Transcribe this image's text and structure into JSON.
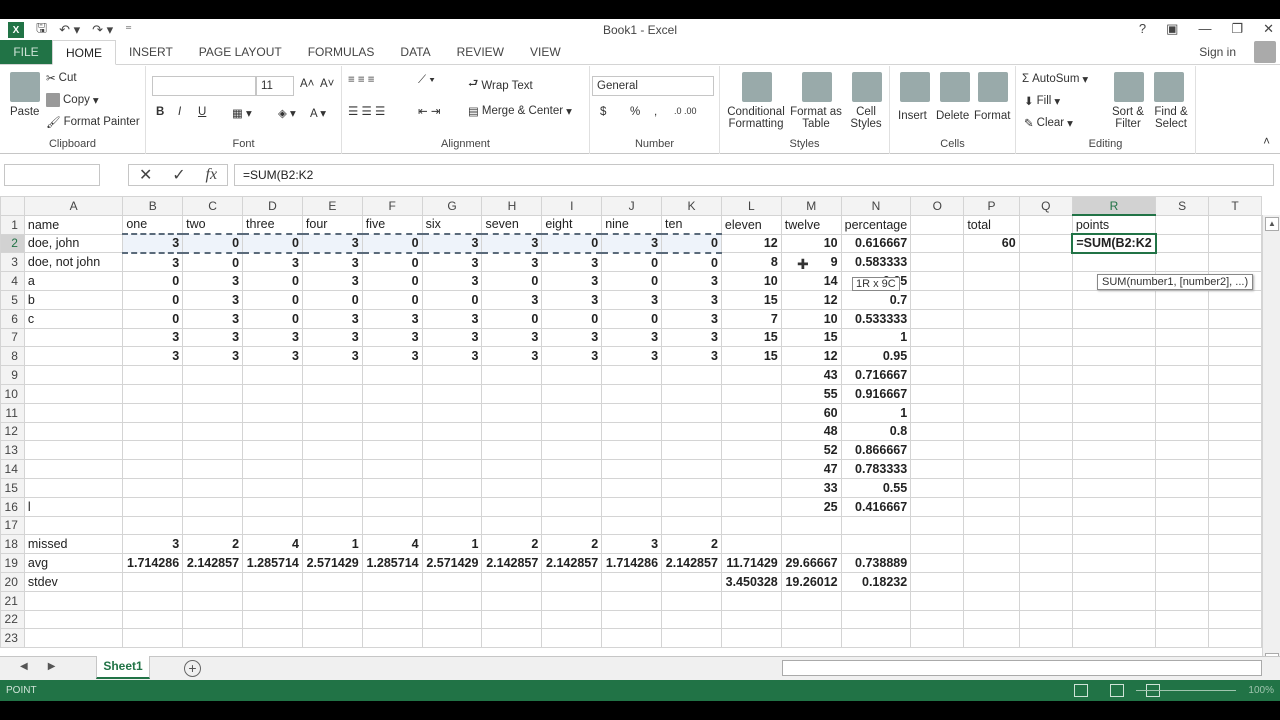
{
  "window": {
    "title": "Book1 - Excel",
    "controls": [
      "?",
      "ribbon-display",
      "minimize",
      "restore",
      "close"
    ]
  },
  "qat": {
    "undo_icon": "undo-icon",
    "redo_icon": "redo-icon",
    "save_icon": "save-icon"
  },
  "tabs": [
    "FILE",
    "HOME",
    "INSERT",
    "PAGE LAYOUT",
    "FORMULAS",
    "DATA",
    "REVIEW",
    "VIEW"
  ],
  "active_tab": "HOME",
  "signin": "Sign in",
  "ribbon": {
    "clipboard": {
      "label": "Clipboard",
      "paste": "Paste",
      "cut": "Cut",
      "copy": "Copy",
      "format_painter": "Format Painter"
    },
    "font": {
      "label": "Font",
      "font_name": "",
      "font_size": "11",
      "bold": "B",
      "italic": "I",
      "underline": "U"
    },
    "alignment": {
      "label": "Alignment",
      "wrap_text": "Wrap Text",
      "merge_center": "Merge & Center"
    },
    "number": {
      "label": "Number",
      "format": "General",
      "currency": "$",
      "percent": "%",
      "comma": ","
    },
    "styles": {
      "label": "Styles",
      "conditional": "Conditional Formatting",
      "format_table": "Format as Table",
      "cell_styles": "Cell Styles"
    },
    "cells": {
      "label": "Cells",
      "insert": "Insert",
      "delete": "Delete",
      "format": "Format"
    },
    "editing": {
      "label": "Editing",
      "autosum": "AutoSum",
      "fill": "Fill",
      "clear": "Clear",
      "sort_filter": "Sort & Filter",
      "find_select": "Find & Select"
    }
  },
  "formula_bar": {
    "name_box": "",
    "cancel": "✕",
    "enter": "✓",
    "fx": "fx",
    "formula": "=SUM(B2:K2"
  },
  "columns": [
    "A",
    "B",
    "C",
    "D",
    "E",
    "F",
    "G",
    "H",
    "I",
    "J",
    "K",
    "L",
    "M",
    "N",
    "O",
    "P",
    "Q",
    "R",
    "S",
    "T"
  ],
  "rows": [
    [
      "name",
      "one",
      "two",
      "three",
      "four",
      "five",
      "six",
      "seven",
      "eight",
      "nine",
      "ten",
      "eleven",
      "twelve",
      "percentage",
      "",
      "total",
      "",
      "points",
      "",
      ""
    ],
    [
      "doe, john",
      "3",
      "0",
      "0",
      "3",
      "0",
      "3",
      "3",
      "0",
      "3",
      "0",
      "12",
      "10",
      "0.616667",
      "",
      "60",
      "",
      "=SUM(B2:K2",
      "",
      ""
    ],
    [
      "doe, not john",
      "3",
      "0",
      "3",
      "3",
      "0",
      "3",
      "3",
      "3",
      "0",
      "0",
      "8",
      "9",
      "0.583333",
      "",
      "",
      "",
      "",
      "",
      ""
    ],
    [
      "a",
      "0",
      "3",
      "0",
      "3",
      "0",
      "3",
      "0",
      "3",
      "0",
      "3",
      "10",
      "14",
      "0.65",
      "",
      "",
      "",
      "",
      "",
      ""
    ],
    [
      "b",
      "0",
      "3",
      "0",
      "0",
      "0",
      "0",
      "3",
      "3",
      "3",
      "3",
      "15",
      "12",
      "0.7",
      "",
      "",
      "",
      "",
      "",
      ""
    ],
    [
      "c",
      "0",
      "3",
      "0",
      "3",
      "3",
      "3",
      "0",
      "0",
      "0",
      "3",
      "7",
      "10",
      "0.533333",
      "",
      "",
      "",
      "",
      "",
      ""
    ],
    [
      "",
      "3",
      "3",
      "3",
      "3",
      "3",
      "3",
      "3",
      "3",
      "3",
      "3",
      "15",
      "15",
      "1",
      "",
      "",
      "",
      "",
      "",
      ""
    ],
    [
      "",
      "3",
      "3",
      "3",
      "3",
      "3",
      "3",
      "3",
      "3",
      "3",
      "3",
      "15",
      "12",
      "0.95",
      "",
      "",
      "",
      "",
      "",
      ""
    ],
    [
      "",
      "",
      "",
      "",
      "",
      "",
      "",
      "",
      "",
      "",
      "",
      "",
      "43",
      "0.716667",
      "",
      "",
      "",
      "",
      "",
      ""
    ],
    [
      "",
      "",
      "",
      "",
      "",
      "",
      "",
      "",
      "",
      "",
      "",
      "",
      "55",
      "0.916667",
      "",
      "",
      "",
      "",
      "",
      ""
    ],
    [
      "",
      "",
      "",
      "",
      "",
      "",
      "",
      "",
      "",
      "",
      "",
      "",
      "60",
      "1",
      "",
      "",
      "",
      "",
      "",
      ""
    ],
    [
      "",
      "",
      "",
      "",
      "",
      "",
      "",
      "",
      "",
      "",
      "",
      "",
      "48",
      "0.8",
      "",
      "",
      "",
      "",
      "",
      ""
    ],
    [
      "",
      "",
      "",
      "",
      "",
      "",
      "",
      "",
      "",
      "",
      "",
      "",
      "52",
      "0.866667",
      "",
      "",
      "",
      "",
      "",
      ""
    ],
    [
      "",
      "",
      "",
      "",
      "",
      "",
      "",
      "",
      "",
      "",
      "",
      "",
      "47",
      "0.783333",
      "",
      "",
      "",
      "",
      "",
      ""
    ],
    [
      "",
      "",
      "",
      "",
      "",
      "",
      "",
      "",
      "",
      "",
      "",
      "",
      "33",
      "0.55",
      "",
      "",
      "",
      "",
      "",
      ""
    ],
    [
      "l",
      "",
      "",
      "",
      "",
      "",
      "",
      "",
      "",
      "",
      "",
      "",
      "25",
      "0.416667",
      "",
      "",
      "",
      "",
      "",
      ""
    ],
    [
      "",
      "",
      "",
      "",
      "",
      "",
      "",
      "",
      "",
      "",
      "",
      "",
      "",
      "",
      "",
      "",
      "",
      "",
      "",
      ""
    ],
    [
      "missed",
      "3",
      "2",
      "4",
      "1",
      "4",
      "1",
      "2",
      "2",
      "3",
      "2",
      "",
      "",
      "",
      "",
      "",
      "",
      "",
      "",
      ""
    ],
    [
      "avg",
      "1.714286",
      "2.142857",
      "1.285714",
      "2.571429",
      "1.285714",
      "2.571429",
      "2.142857",
      "2.142857",
      "1.714286",
      "2.142857",
      "11.71429",
      "29.66667",
      "0.738889",
      "",
      "",
      "",
      "",
      "",
      ""
    ],
    [
      "stdev",
      "",
      "",
      "",
      "",
      "",
      "",
      "",
      "",
      "",
      "",
      "3.450328",
      "19.26012",
      "0.18232",
      "",
      "",
      "",
      "",
      "",
      ""
    ],
    [
      "",
      "",
      "",
      "",
      "",
      "",
      "",
      "",
      "",
      "",
      "",
      "",
      "",
      "",
      "",
      "",
      "",
      "",
      "",
      ""
    ],
    [
      "",
      "",
      "",
      "",
      "",
      "",
      "",
      "",
      "",
      "",
      "",
      "",
      "",
      "",
      "",
      "",
      "",
      "",
      "",
      ""
    ],
    [
      "",
      "",
      "",
      "",
      "",
      "",
      "",
      "",
      "",
      "",
      "",
      "",
      "",
      "",
      "",
      "",
      "",
      "",
      "",
      ""
    ]
  ],
  "tooltip": "SUM(number1, [number2], ...)",
  "size_tip": "1R x 9C",
  "sheets": [
    "Sheet1"
  ],
  "status": {
    "mode": "POINT",
    "zoom": "100%"
  },
  "colors": {
    "accent": "#217346"
  }
}
